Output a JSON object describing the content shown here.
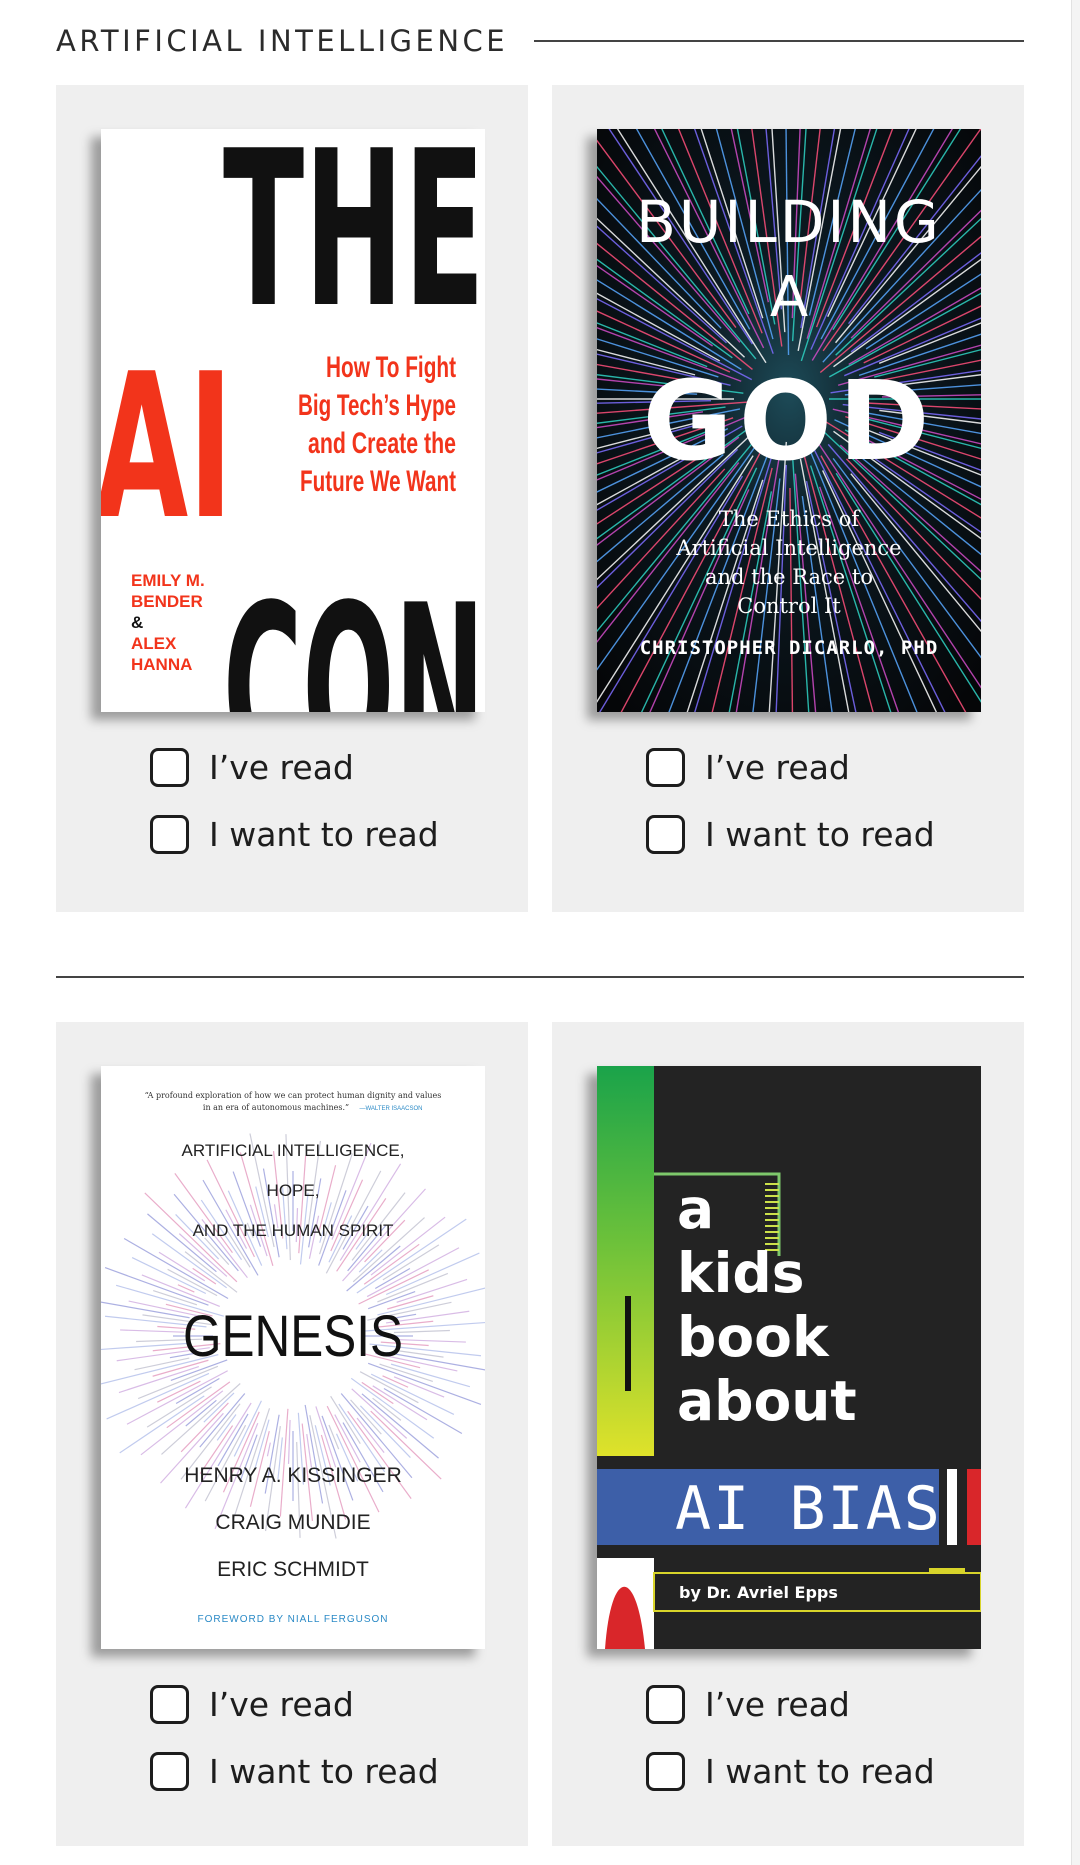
{
  "section": {
    "title": "ARTIFICIAL INTELLIGENCE"
  },
  "books": [
    {
      "cover": {
        "title_top": "THE",
        "title_left": "AI",
        "title_bottom": "CON",
        "subtitle_lines": [
          "How To Fight",
          "Big Tech’s Hype",
          "and Create the",
          "Future We Want"
        ],
        "author_lines": [
          "EMILY M.",
          "BENDER",
          "&",
          "ALEX",
          "HANNA"
        ]
      },
      "read_label": "I’ve read",
      "want_label": "I want to read"
    },
    {
      "cover": {
        "title_lines": [
          "BUILDING",
          "A",
          "GOD"
        ],
        "subtitle_lines": [
          "The Ethics of",
          "Artificial Intelligence",
          "and the Race to",
          "Control It"
        ],
        "author": "CHRISTOPHER DICARLO, PHD"
      },
      "read_label": "I’ve read",
      "want_label": "I want to read"
    },
    {
      "cover": {
        "quote": "“A profound exploration of how we can protect human dignity and values",
        "quote_line2": "in an era of autonomous machines.”",
        "quote_attribution": "—WALTER ISAACSON",
        "subtitle_lines": [
          "ARTIFICIAL INTELLIGENCE,",
          "HOPE,",
          "AND THE HUMAN SPIRIT"
        ],
        "title": "GENESIS",
        "author_lines": [
          "HENRY A. KISSINGER",
          "CRAIG MUNDIE",
          "ERIC SCHMIDT"
        ],
        "foreword": "FOREWORD BY NIALL FERGUSON"
      },
      "read_label": "I’ve read",
      "want_label": "I want to read"
    },
    {
      "cover": {
        "title_lines": [
          "a",
          "kids",
          "book",
          "about"
        ],
        "topic": "AI BIAS",
        "author": "by Dr. Avriel Epps"
      },
      "read_label": "I’ve read",
      "want_label": "I want to read"
    }
  ],
  "colors": {
    "card_bg": "#efefef",
    "ai_con_red": "#f2341b",
    "kids_book_blue": "#3d5fa8",
    "kids_book_green": "#1aa34a"
  }
}
